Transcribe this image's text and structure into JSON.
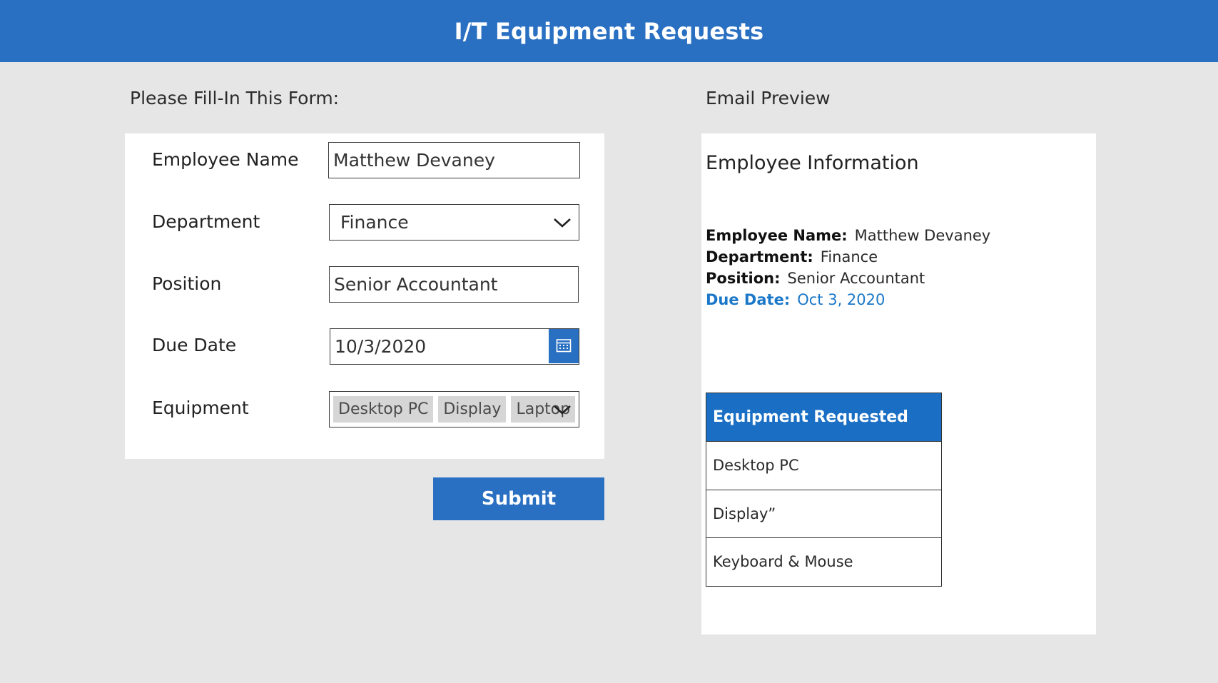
{
  "header": {
    "title": "I/T Equipment Requests"
  },
  "form": {
    "section_title": "Please Fill-In This Form:",
    "fields": {
      "employee_name": {
        "label": "Employee Name",
        "value": "Matthew Devaney"
      },
      "department": {
        "label": "Department",
        "value": "Finance"
      },
      "position": {
        "label": "Position",
        "value": "Senior Accountant"
      },
      "due_date": {
        "label": "Due Date",
        "value": "10/3/2020"
      },
      "equipment": {
        "label": "Equipment",
        "selected": [
          "Desktop PC",
          "Display",
          "Laptop"
        ]
      }
    },
    "submit_label": "Submit"
  },
  "preview": {
    "section_title": "Email Preview",
    "heading": "Employee Information",
    "info": {
      "employee_name": {
        "label": "Employee Name:",
        "value": "Matthew Devaney"
      },
      "department": {
        "label": "Department:",
        "value": "Finance"
      },
      "position": {
        "label": "Position:",
        "value": "Senior Accountant"
      },
      "due_date": {
        "label": "Due Date:",
        "value": "Oct 3, 2020"
      }
    },
    "equipment_table": {
      "header": "Equipment Requested",
      "rows": [
        "Desktop PC",
        "Display”",
        "Keyboard & Mouse"
      ]
    }
  },
  "colors": {
    "header_bg": "#2a70c2",
    "table_header_bg": "#1a6fc4",
    "due_date_text": "#1b78c8",
    "page_bg": "#e6e6e6"
  },
  "icons": {
    "dropdown": "chevron-down-icon",
    "date_picker": "calendar-icon"
  }
}
